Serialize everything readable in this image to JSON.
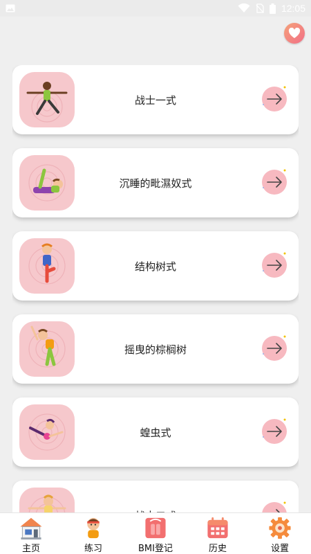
{
  "status_bar": {
    "time": "12:05",
    "icons": [
      "image-icon",
      "wifi-icon",
      "no-sim-icon",
      "battery-icon"
    ]
  },
  "header": {
    "favorite_icon": "heart-icon"
  },
  "poses": [
    {
      "name": "战士一式",
      "icon": "warrior-pose-illustration"
    },
    {
      "name": "沉睡的毗濕奴式",
      "icon": "sleeping-vishnu-pose-illustration"
    },
    {
      "name": "结构树式",
      "icon": "tree-pose-illustration"
    },
    {
      "name": "摇曳的棕榈树",
      "icon": "swaying-palm-pose-illustration"
    },
    {
      "name": "蝗虫式",
      "icon": "locust-pose-illustration"
    },
    {
      "name": "战士二式",
      "icon": "warrior-two-pose-illustration"
    }
  ],
  "bottom_nav": [
    {
      "label": "主页",
      "icon": "home-icon"
    },
    {
      "label": "练习",
      "icon": "exercise-icon"
    },
    {
      "label": "BMI登记",
      "icon": "bmi-icon"
    },
    {
      "label": "历史",
      "icon": "calendar-icon"
    },
    {
      "label": "设置",
      "icon": "gear-icon"
    }
  ],
  "colors": {
    "background": "#efefef",
    "thumb_bg": "#f6c8cc",
    "arrow_bg": "#f7b9c0",
    "accent": "#f26f86"
  }
}
